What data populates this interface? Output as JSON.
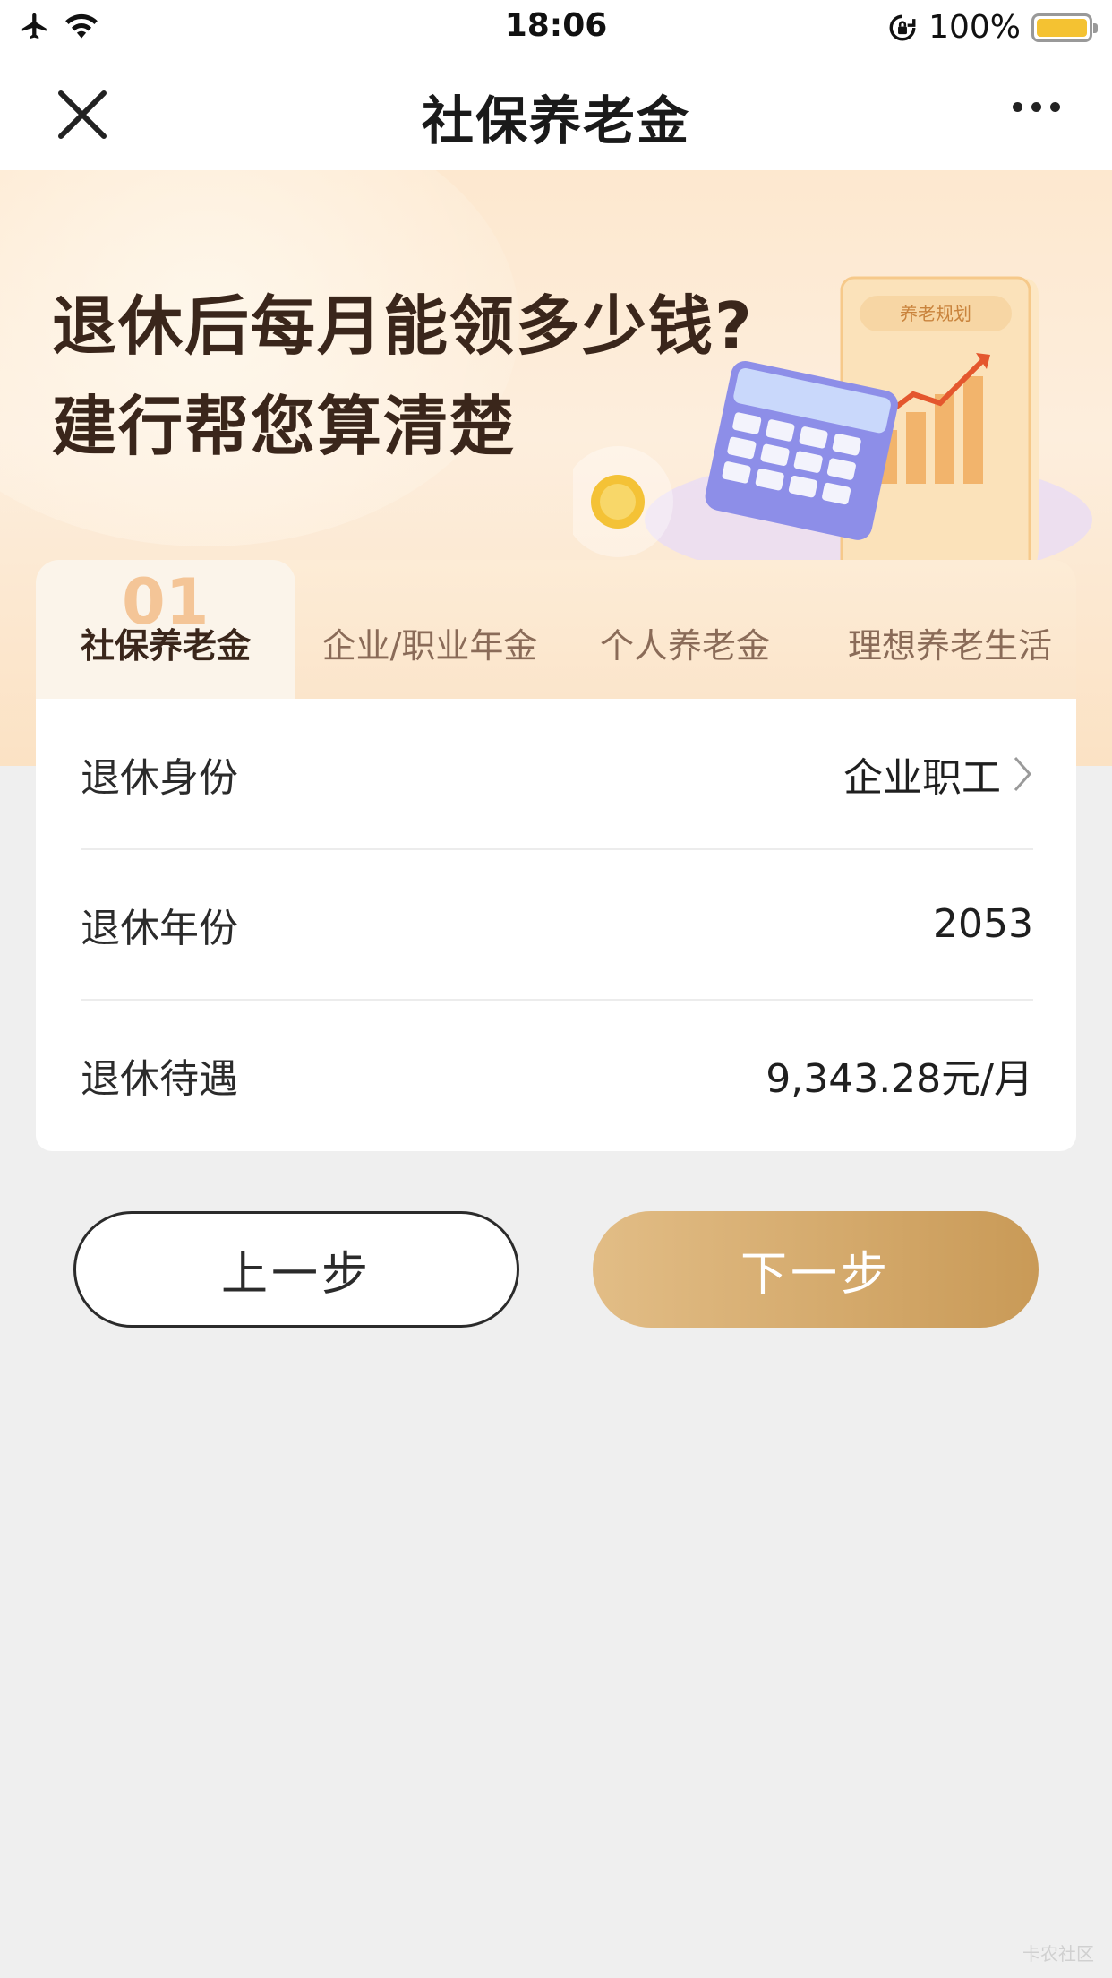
{
  "status_bar": {
    "time": "18:06",
    "battery_percent": "100%",
    "battery_level": 1.0,
    "battery_color": "#f4c232"
  },
  "nav": {
    "title": "社保养老金",
    "close_icon": "close-icon",
    "more_icon": "more-icon"
  },
  "banner": {
    "line1": "退休后每月能领多少钱?",
    "line2": "建行帮您算清楚",
    "illustration_caption": "养老规划"
  },
  "tabs": [
    {
      "number": "01",
      "label": "社保养老金",
      "active": true
    },
    {
      "label": "企业/职业年金",
      "active": false
    },
    {
      "label": "个人养老金",
      "active": false
    },
    {
      "label": "理想养老生活",
      "active": false
    }
  ],
  "form": {
    "rows": [
      {
        "label": "退休身份",
        "value": "企业职工"
      },
      {
        "label": "退休年份",
        "value": "2053"
      },
      {
        "label": "退休待遇",
        "value": "9,343.28元/月"
      }
    ]
  },
  "buttons": {
    "prev": "上一步",
    "next": "下一步"
  },
  "watermark": "卡农社区",
  "colors": {
    "accent_gold": "#c99a57",
    "banner_bg": "#fde8cf",
    "page_bg": "#efefef"
  }
}
